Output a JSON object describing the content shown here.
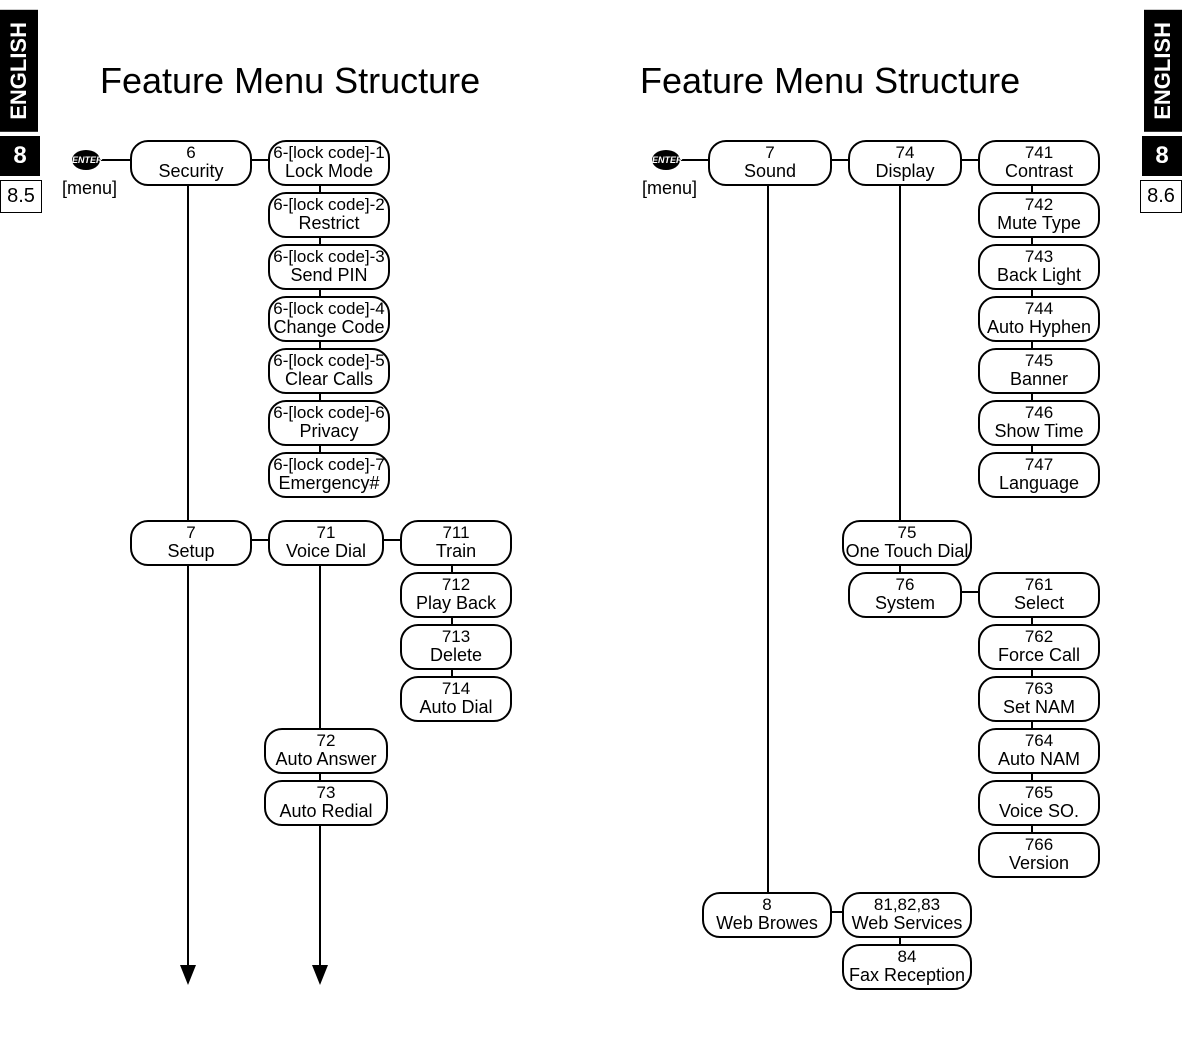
{
  "sideTabs": {
    "english": "ENGLISH",
    "chapter": "8",
    "sectionLeft": "8.5",
    "sectionRight": "8.6"
  },
  "titleLeft": "Feature Menu Structure",
  "titleRight": "Feature Menu Structure",
  "enterLabel": "ENTER",
  "menuLabel": "[menu]",
  "left": {
    "security": {
      "num": "6",
      "label": "Security"
    },
    "lockMode": {
      "num": "6-[lock code]-1",
      "label": "Lock Mode"
    },
    "restrict": {
      "num": "6-[lock code]-2",
      "label": "Restrict"
    },
    "sendPin": {
      "num": "6-[lock code]-3",
      "label": "Send PIN"
    },
    "changeCode": {
      "num": "6-[lock code]-4",
      "label": "Change Code"
    },
    "clearCalls": {
      "num": "6-[lock code]-5",
      "label": "Clear Calls"
    },
    "privacy": {
      "num": "6-[lock code]-6",
      "label": "Privacy"
    },
    "emergency": {
      "num": "6-[lock code]-7",
      "label": "Emergency#"
    },
    "setup": {
      "num": "7",
      "label": "Setup"
    },
    "voiceDial": {
      "num": "71",
      "label": "Voice Dial"
    },
    "train": {
      "num": "711",
      "label": "Train"
    },
    "playBack": {
      "num": "712",
      "label": "Play Back"
    },
    "delete": {
      "num": "713",
      "label": "Delete"
    },
    "autoDial": {
      "num": "714",
      "label": "Auto Dial"
    },
    "autoAnswer": {
      "num": "72",
      "label": "Auto Answer"
    },
    "autoRedial": {
      "num": "73",
      "label": "Auto Redial"
    }
  },
  "right": {
    "sound": {
      "num": "7",
      "label": "Sound"
    },
    "display": {
      "num": "74",
      "label": "Display"
    },
    "contrast": {
      "num": "741",
      "label": "Contrast"
    },
    "muteType": {
      "num": "742",
      "label": "Mute Type"
    },
    "backLight": {
      "num": "743",
      "label": "Back Light"
    },
    "autoHyphen": {
      "num": "744",
      "label": "Auto Hyphen"
    },
    "banner": {
      "num": "745",
      "label": "Banner"
    },
    "showTime": {
      "num": "746",
      "label": "Show Time"
    },
    "language": {
      "num": "747",
      "label": "Language"
    },
    "oneTouch": {
      "num": "75",
      "label": "One Touch Dial"
    },
    "system": {
      "num": "76",
      "label": "System"
    },
    "select": {
      "num": "761",
      "label": "Select"
    },
    "forceCall": {
      "num": "762",
      "label": "Force Call"
    },
    "setNam": {
      "num": "763",
      "label": "Set NAM"
    },
    "autoNam": {
      "num": "764",
      "label": "Auto NAM"
    },
    "voiceSo": {
      "num": "765",
      "label": "Voice SO."
    },
    "version": {
      "num": "766",
      "label": "Version"
    },
    "webBrowes": {
      "num": "8",
      "label": "Web Browes"
    },
    "webServices": {
      "num": "81,82,83",
      "label": "Web Services"
    },
    "faxReception": {
      "num": "84",
      "label": "Fax Reception"
    }
  }
}
